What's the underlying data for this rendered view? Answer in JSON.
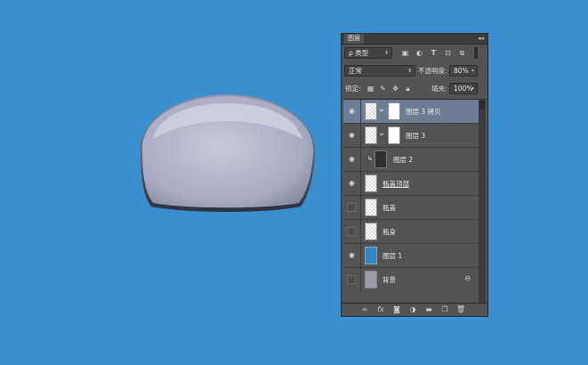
{
  "panel": {
    "tab_label": "图层",
    "close_glyph": "◂◂",
    "menu_glyph": "≡"
  },
  "filter": {
    "kind_label": "ρ 类型",
    "icons": [
      "image-filter-icon",
      "adjustment-filter-icon",
      "type-filter-icon",
      "shape-filter-icon",
      "smart-object-filter-icon"
    ]
  },
  "blend": {
    "mode": "正常",
    "opacity_label": "不透明度:",
    "opacity_value": "80%"
  },
  "lock": {
    "label": "锁定:",
    "fill_label": "填充:",
    "fill_value": "100%"
  },
  "layers": [
    {
      "name": "图层 3 拷贝",
      "visible": true,
      "active": true,
      "thumb": "checker",
      "mask": true,
      "linked": true,
      "underline": false
    },
    {
      "name": "图层 3",
      "visible": true,
      "active": false,
      "thumb": "checker",
      "mask": true,
      "linked": true,
      "underline": false
    },
    {
      "name": "图层 2",
      "visible": true,
      "active": false,
      "thumb": "dark",
      "mask": false,
      "clipped": true,
      "underline": false
    },
    {
      "name": "瓶盖顶部",
      "visible": true,
      "active": false,
      "thumb": "checker",
      "mask": false,
      "underline": true
    },
    {
      "name": "瓶盖",
      "visible": false,
      "active": false,
      "thumb": "checker",
      "mask": false,
      "underline": false
    },
    {
      "name": "瓶身",
      "visible": false,
      "active": false,
      "thumb": "checker",
      "mask": false,
      "underline": false
    },
    {
      "name": "图层 1",
      "visible": true,
      "active": false,
      "thumb": "blue",
      "mask": false,
      "underline": false
    },
    {
      "name": "背景",
      "visible": false,
      "active": false,
      "thumb": "gray",
      "mask": false,
      "locked": true,
      "underline": false
    }
  ],
  "bottom_icons": [
    "link-layers-icon",
    "fx-icon",
    "add-mask-icon",
    "adjustment-layer-icon",
    "new-group-icon",
    "new-layer-icon",
    "delete-layer-icon"
  ],
  "colors": {
    "canvas_bg": "#3a8fcf",
    "panel_bg": "#535353",
    "active_layer": "#6d7d95"
  }
}
